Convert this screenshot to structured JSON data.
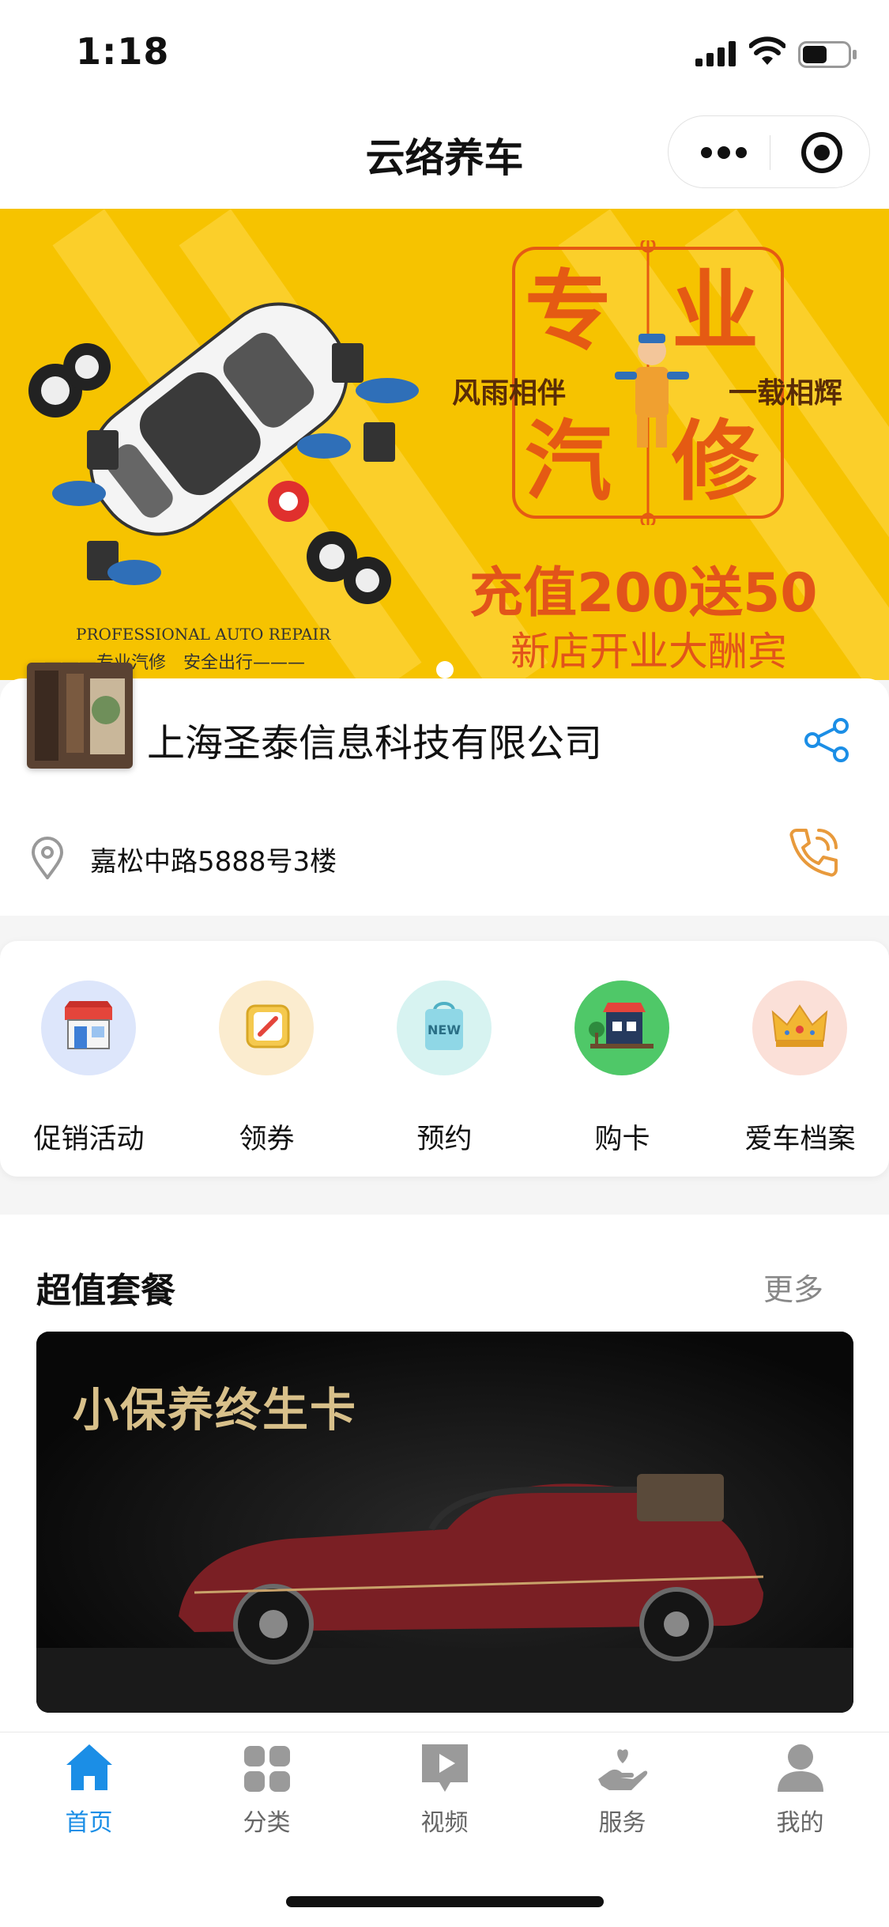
{
  "status": {
    "time": "1:18"
  },
  "nav": {
    "title": "云络养车"
  },
  "banner": {
    "big_chars": [
      "专",
      "业",
      "汽",
      "修"
    ],
    "slogan_left": "风雨相伴",
    "slogan_right": "一载相辉",
    "promo": "充值200送50",
    "promo_sub": "新店开业大酬宾",
    "pro_repair": "PROFESSIONAL AUTO REPAIR",
    "pro_sub": "———专业汽修　安全出行———"
  },
  "store": {
    "name": "上海圣泰信息科技有限公司",
    "address": "嘉松中路5888号3楼"
  },
  "menu": {
    "items": [
      {
        "label": "促销活动",
        "icon": "shop-icon",
        "bg": "#dde6fb"
      },
      {
        "label": "领券",
        "icon": "coupon-icon",
        "bg": "#fbeccf"
      },
      {
        "label": "预约",
        "icon": "new-bag-icon",
        "bg": "#d7f3f1"
      },
      {
        "label": "购卡",
        "icon": "store-card-icon",
        "bg": "#4fc868"
      },
      {
        "label": "爱车档案",
        "icon": "crown-icon",
        "bg": "#fbe0d8"
      }
    ]
  },
  "packages": {
    "title": "超值套餐",
    "more": "更多",
    "card_title": "小保养终生卡"
  },
  "tabs": [
    {
      "label": "首页",
      "icon": "home-icon",
      "active": true
    },
    {
      "label": "分类",
      "icon": "grid-icon",
      "active": false
    },
    {
      "label": "视频",
      "icon": "video-icon",
      "active": false
    },
    {
      "label": "服务",
      "icon": "service-icon",
      "active": false
    },
    {
      "label": "我的",
      "icon": "user-icon",
      "active": false
    }
  ],
  "colors": {
    "accent": "#1b8ee6",
    "banner_bg": "#f6c300",
    "promo": "#e2541a",
    "phone": "#e89a3c"
  }
}
